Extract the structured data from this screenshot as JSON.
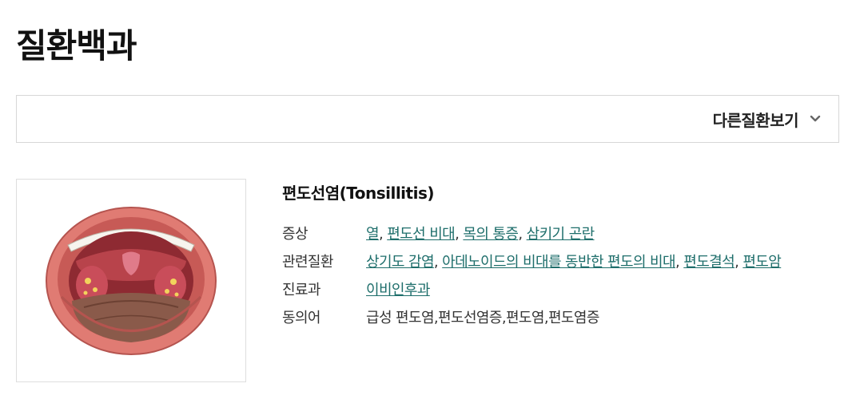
{
  "page": {
    "title": "질환백과"
  },
  "selector": {
    "label": "다른질환보기"
  },
  "disease": {
    "title": "편도선염(Tonsillitis)",
    "rows": {
      "symptoms": {
        "label": "증상",
        "links": [
          "열",
          "편도선 비대",
          "목의 통증",
          "삼키기 곤란"
        ]
      },
      "related": {
        "label": "관련질환",
        "links": [
          "상기도 감염",
          "아데노이드의 비대를 동반한 편도의 비대",
          "편도결석",
          "편도암"
        ]
      },
      "department": {
        "label": "진료과",
        "links": [
          "이비인후과"
        ]
      },
      "synonyms": {
        "label": "동의어",
        "value": "급성 편도염,편도선염증,편도염,편도염증"
      }
    }
  },
  "colors": {
    "link": "#1e6e6b",
    "border": "#d7d7d7"
  },
  "icons": {
    "selector": "chevron-down-icon"
  }
}
